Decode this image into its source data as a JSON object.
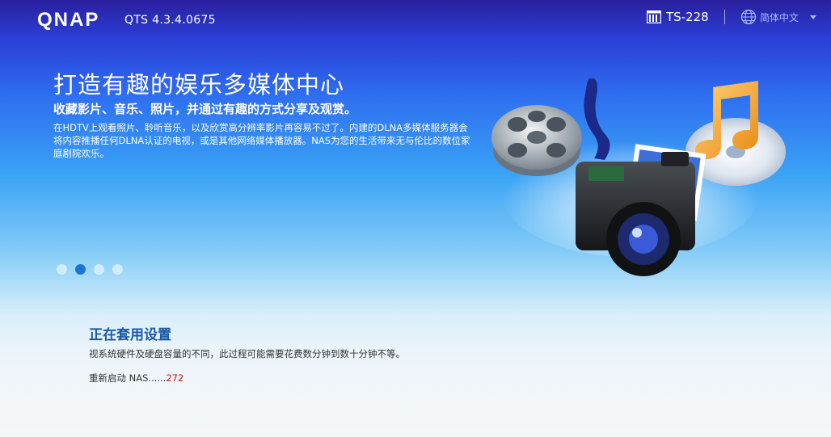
{
  "header": {
    "brand": "QNAP",
    "version": "QTS 4.3.4.0675",
    "model": "TS-228",
    "language": "简体中文"
  },
  "hero": {
    "title": "打造有趣的娱乐多媒体中心",
    "subtitle": "收藏影片、音乐、照片，并通过有趣的方式分享及观赏。",
    "body": "在HDTV上观看照片、聆听音乐，以及欣赏高分辨率影片再容易不过了。内建的DLNA多媒体服务器会将内容推播任何DLNA认证的电视，或是其他网络媒体播放器。NAS为您的生活带来无与伦比的数位家庭剧院欢乐。"
  },
  "carousel": {
    "count": 4,
    "active_index": 1
  },
  "status": {
    "title": "正在套用设置",
    "description": "视系统硬件及硬盘容量的不同，此过程可能需要花费数分钟到数十分钟不等。",
    "restart_label": "重新启动 NAS......",
    "countdown": "272"
  },
  "colors": {
    "accent": "#1a5aa6",
    "countdown": "#d01010",
    "dot_active": "#1a76d2"
  }
}
